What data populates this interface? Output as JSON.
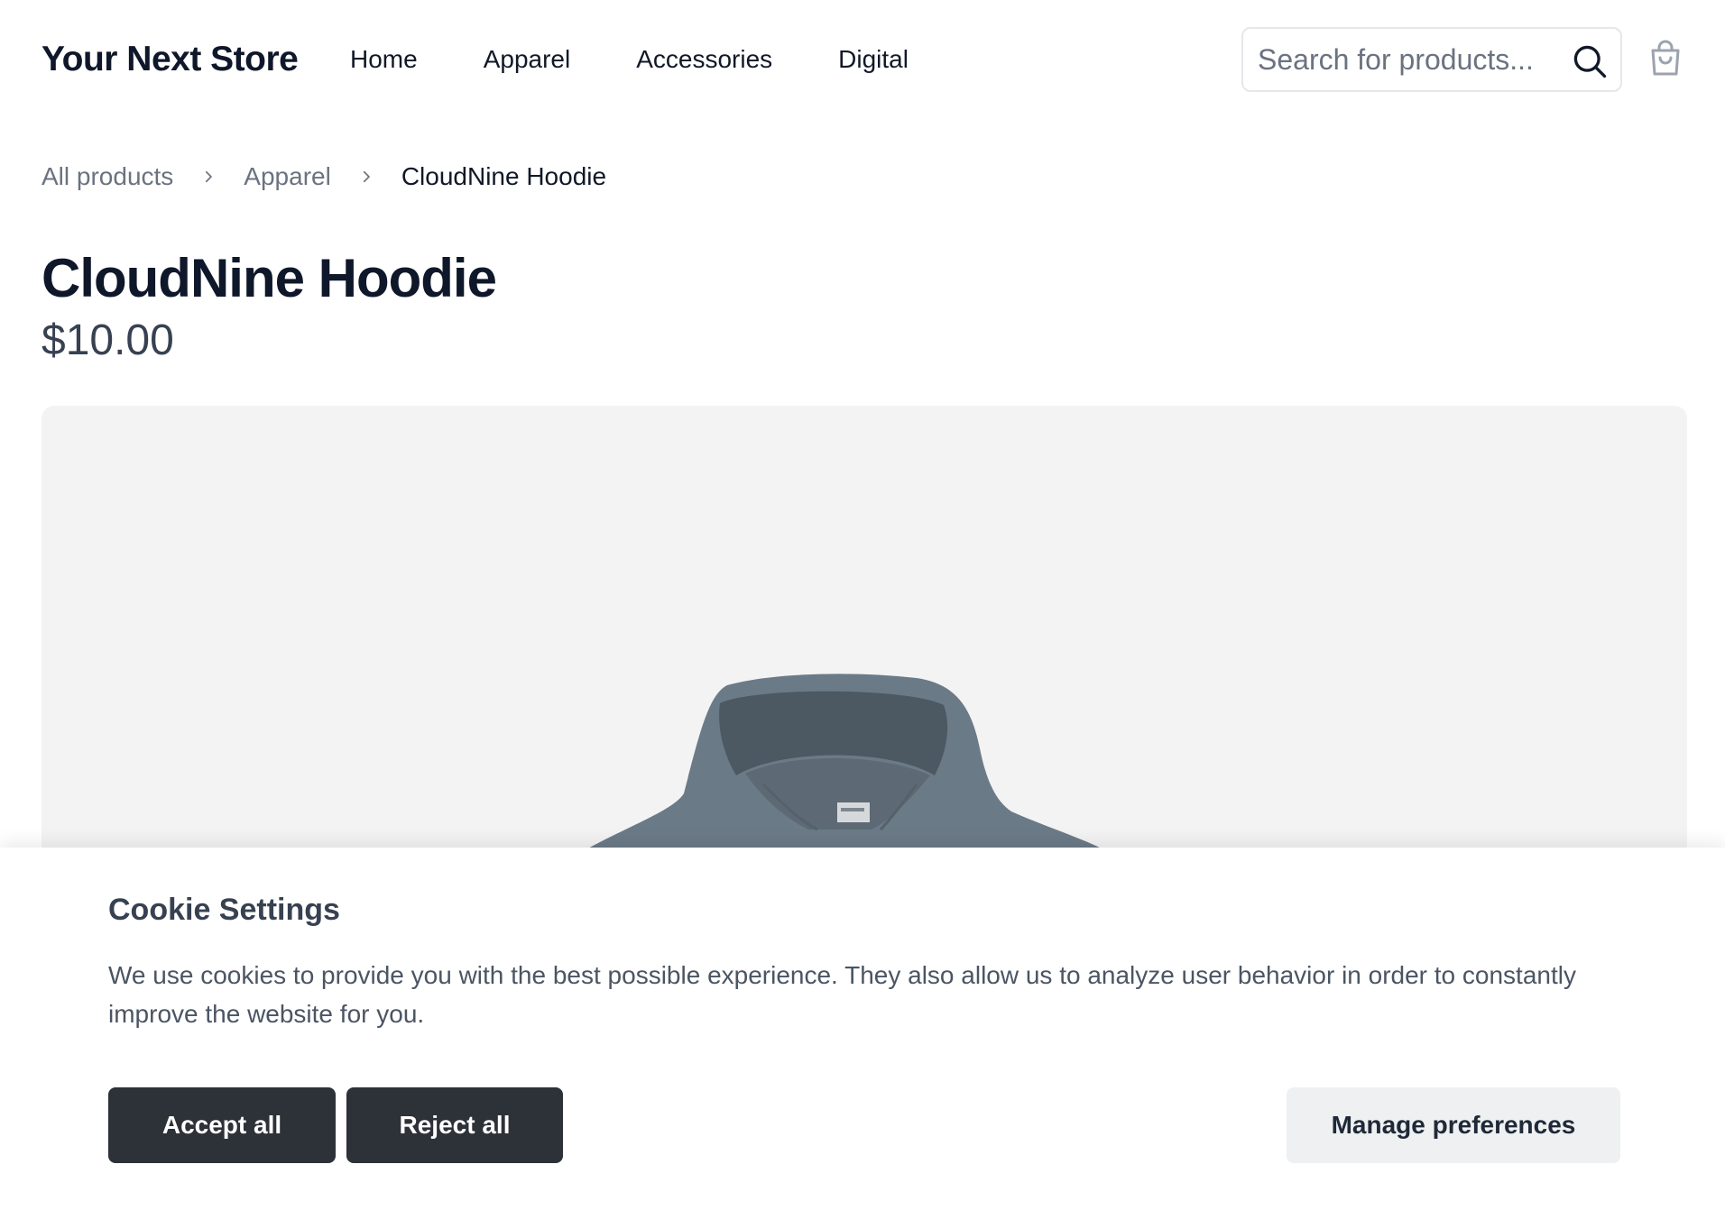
{
  "header": {
    "brand": "Your Next Store",
    "nav": [
      "Home",
      "Apparel",
      "Accessories",
      "Digital"
    ],
    "search_placeholder": "Search for products...",
    "search_icon": "search-icon",
    "cart_icon": "shopping-bag-icon"
  },
  "breadcrumb": {
    "items": [
      "All products",
      "Apparel",
      "CloudNine Hoodie"
    ],
    "separator_icon": "chevron-right-icon"
  },
  "product": {
    "title": "CloudNine Hoodie",
    "price": "$10.00",
    "image_subject": "hoodie",
    "image_color": "#6b7a87"
  },
  "cookie_banner": {
    "title": "Cookie Settings",
    "text": "We use cookies to provide you with the best possible experience. They also allow us to analyze user behavior in order to constantly improve the website for you.",
    "accept_label": "Accept all",
    "reject_label": "Reject all",
    "manage_label": "Manage preferences"
  },
  "colors": {
    "primary_button": "#2d3138",
    "secondary_button": "#eef0f2",
    "image_background": "#f3f3f3"
  }
}
